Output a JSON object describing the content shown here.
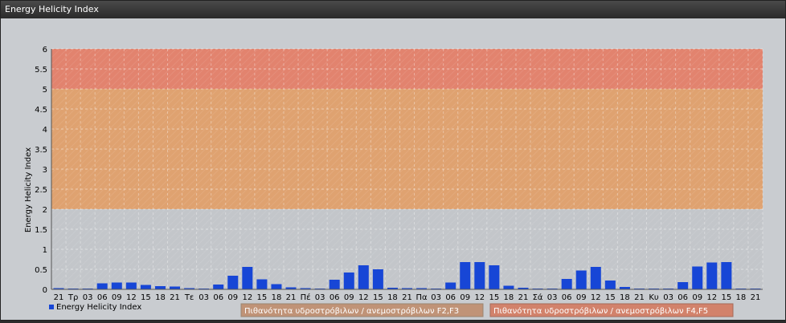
{
  "window": {
    "title": "Energy Helicity Index"
  },
  "chart_data": {
    "type": "bar",
    "ylabel": "Energy Helicity Index",
    "ylim": [
      0,
      6
    ],
    "yticks": [
      "0",
      "0.5",
      "1",
      "1.5",
      "2",
      "2.5",
      "3",
      "3.5",
      "4",
      "4.5",
      "5",
      "5.5",
      "6"
    ],
    "categories": [
      "21",
      "Τρ",
      "03",
      "06",
      "09",
      "12",
      "15",
      "18",
      "21",
      "Τε",
      "03",
      "06",
      "09",
      "12",
      "15",
      "18",
      "21",
      "Πέ",
      "03",
      "06",
      "09",
      "12",
      "15",
      "18",
      "21",
      "Πα",
      "03",
      "06",
      "09",
      "12",
      "15",
      "18",
      "21",
      "Σά",
      "03",
      "06",
      "09",
      "12",
      "15",
      "18",
      "21",
      "Κυ",
      "03",
      "06",
      "09",
      "12",
      "15",
      "18",
      "21"
    ],
    "series": [
      {
        "name": "Energy Helicity Index",
        "color": "#1746d6",
        "values": [
          0.03,
          0.02,
          0.02,
          0.15,
          0.17,
          0.17,
          0.11,
          0.08,
          0.07,
          0.03,
          0.02,
          0.12,
          0.34,
          0.56,
          0.25,
          0.13,
          0.05,
          0.03,
          0.02,
          0.24,
          0.42,
          0.6,
          0.5,
          0.04,
          0.03,
          0.03,
          0.02,
          0.17,
          0.68,
          0.68,
          0.6,
          0.09,
          0.04,
          0.02,
          0.02,
          0.26,
          0.47,
          0.56,
          0.22,
          0.06,
          0.02,
          0.02,
          0.02,
          0.18,
          0.57,
          0.67,
          0.68,
          0.02,
          0.02
        ]
      }
    ],
    "bands": [
      {
        "from": 5,
        "to": 6,
        "color": "#e2836e"
      },
      {
        "from": 2,
        "to": 5,
        "color": "#dfa270"
      }
    ],
    "legend": {
      "series_label": "Energy Helicity Index",
      "band1_label": "Πιθανότητα υδροστρόβιλων / ανεμοστρόβιλων F2,F3",
      "band1_color": "#c09377",
      "band2_label": "Πιθανότητα υδροστρόβιλων / ανεμοστρόβιλων F4,F5",
      "band2_color": "#d2826b"
    },
    "grid": true,
    "legend_placement": "bottom"
  }
}
